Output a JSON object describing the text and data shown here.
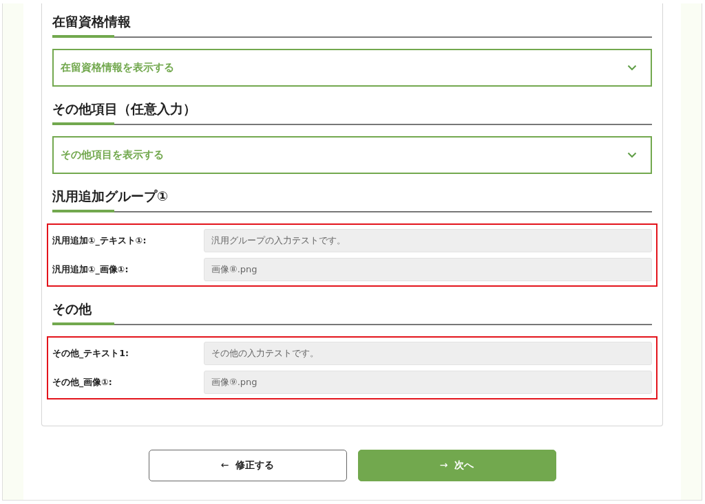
{
  "sections": [
    {
      "title": "在留資格情報",
      "kind": "accordion",
      "toggle": {
        "label": "在留資格情報を表示する",
        "expanded": false
      }
    },
    {
      "title": "その他項目（任意入力）",
      "kind": "accordion",
      "toggle": {
        "label": "その他項目を表示する",
        "expanded": false
      }
    },
    {
      "title": "汎用追加グループ①",
      "kind": "fields",
      "highlighted": true,
      "fields": [
        {
          "label": "汎用追加①_テキスト①:",
          "value": "汎用グループの入力テストです。"
        },
        {
          "label": "汎用追加①_画像①:",
          "value": "画像⑧.png"
        }
      ]
    },
    {
      "title": "その他",
      "kind": "fields",
      "highlighted": true,
      "fields": [
        {
          "label": "その他_テキスト1:",
          "value": "その他の入力テストです。"
        },
        {
          "label": "その他_画像①:",
          "value": "画像⑨.png"
        }
      ]
    }
  ],
  "buttons": [
    {
      "kind": "back",
      "icon": "←",
      "label": "修正する"
    },
    {
      "kind": "next",
      "icon": "→",
      "label": "次へ"
    }
  ]
}
